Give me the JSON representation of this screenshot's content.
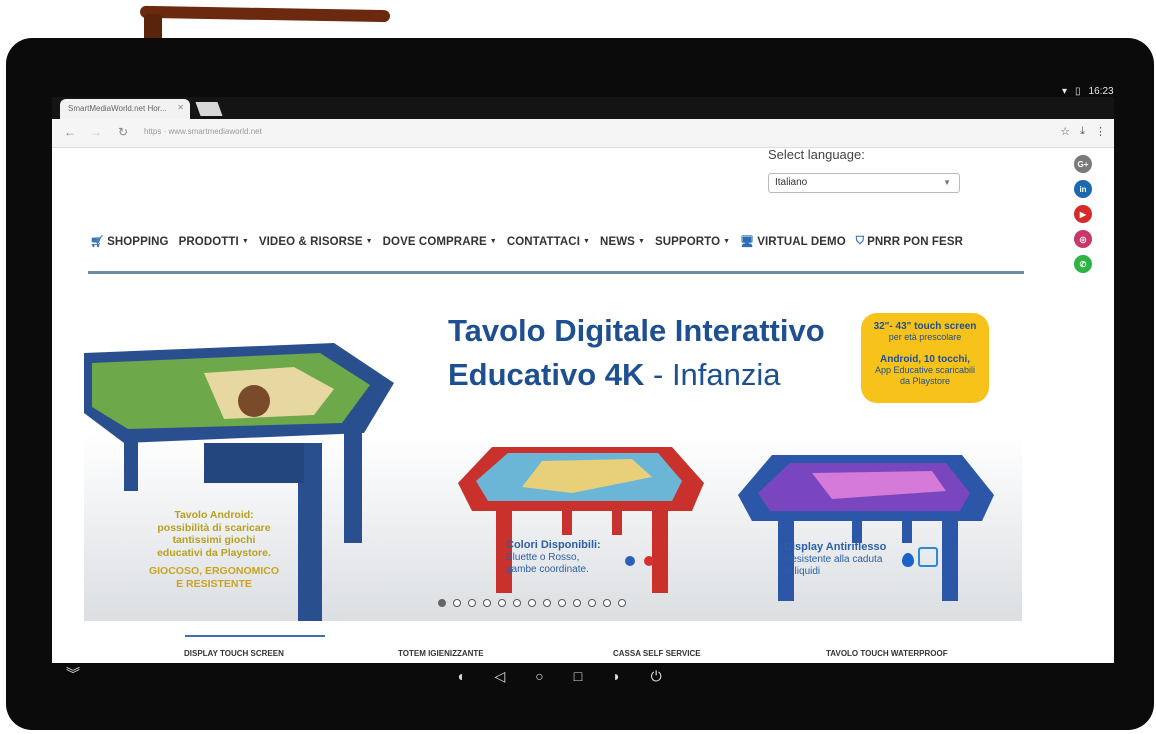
{
  "statusbar": {
    "time": "16:23",
    "wifi_icon": "wifi-icon",
    "battery_icon": "battery-icon"
  },
  "browser": {
    "tab_title": "SmartMediaWorld.net Hor...",
    "url_text": "https · www.smartmediaworld.net"
  },
  "language": {
    "label": "Select language:",
    "selected": "Italiano"
  },
  "social": [
    {
      "name": "google-plus",
      "glyph": "G+",
      "color": "#7a7a7a"
    },
    {
      "name": "linkedin",
      "glyph": "in",
      "color": "#1b68b0"
    },
    {
      "name": "youtube",
      "glyph": "▶",
      "color": "#d62b2b"
    },
    {
      "name": "instagram",
      "glyph": "◎",
      "color": "#c9366a"
    },
    {
      "name": "whatsapp",
      "glyph": "✆",
      "color": "#2fb344"
    }
  ],
  "menu": {
    "shopping": "SHOPPING",
    "prodotti": "PRODOTTI",
    "video": "VIDEO & RISORSE",
    "dove": "DOVE COMPRARE",
    "contattaci": "CONTATTACI",
    "news": "NEWS",
    "supporto": "SUPPORTO",
    "virtual": "VIRTUAL DEMO",
    "pnrr": "PNRR PON FESR"
  },
  "banner": {
    "title_line1": "Tavolo Digitale Interattivo",
    "title_line2_bold": "Educativo 4K",
    "title_line2_light": " - Infanzia",
    "badge_line1": "32\"- 43\" touch screen",
    "badge_line2": "per età prescolare",
    "badge_line3": "Android, 10 tocchi,",
    "badge_line4": "App Educative scaricabili",
    "badge_line5": "da Playstore",
    "left_line1": "Tavolo Android:",
    "left_line2": "possibilità di scaricare",
    "left_line3": "tantissimi giochi",
    "left_line4": "educativi da Playstore.",
    "left_line5": "GIOCOSO, ERGONOMICO",
    "left_line6": "E RESISTENTE",
    "colori_title": "Colori Disponibili:",
    "colori_line1": "Bluette o Rosso,",
    "colori_line2": "gambe coordinate.",
    "display_title": "Display Antiriflesso",
    "display_line1": "Resistente alla caduta",
    "display_line2": "di liquidi",
    "carousel_count": 13,
    "carousel_active": 0
  },
  "bottom_tabs": [
    "DISPLAY TOUCH SCREEN",
    "TOTEM IGIENIZZANTE",
    "CASSA SELF SERVICE",
    "TAVOLO TOUCH WATERPROOF"
  ],
  "android_nav": [
    "volume-down-icon",
    "back-icon",
    "home-icon",
    "recents-icon",
    "volume-up-icon",
    "power-icon"
  ]
}
